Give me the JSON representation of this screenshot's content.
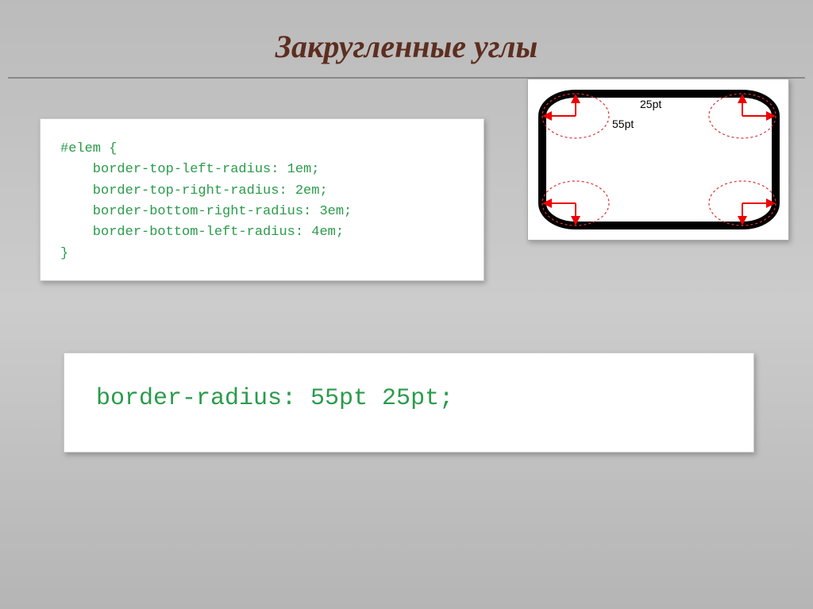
{
  "title": "Закругленные углы",
  "code1": {
    "line1": "#elem {",
    "line2": "    border-top-left-radius: 1em;",
    "line3": "    border-top-right-radius: 2em;",
    "line4": "    border-bottom-right-radius: 3em;",
    "line5": "    border-bottom-left-radius: 4em;",
    "line6": "}"
  },
  "diagram": {
    "label_y": "25pt",
    "label_x": "55pt"
  },
  "code2": {
    "line1": "border-radius: 55pt 25pt;"
  }
}
